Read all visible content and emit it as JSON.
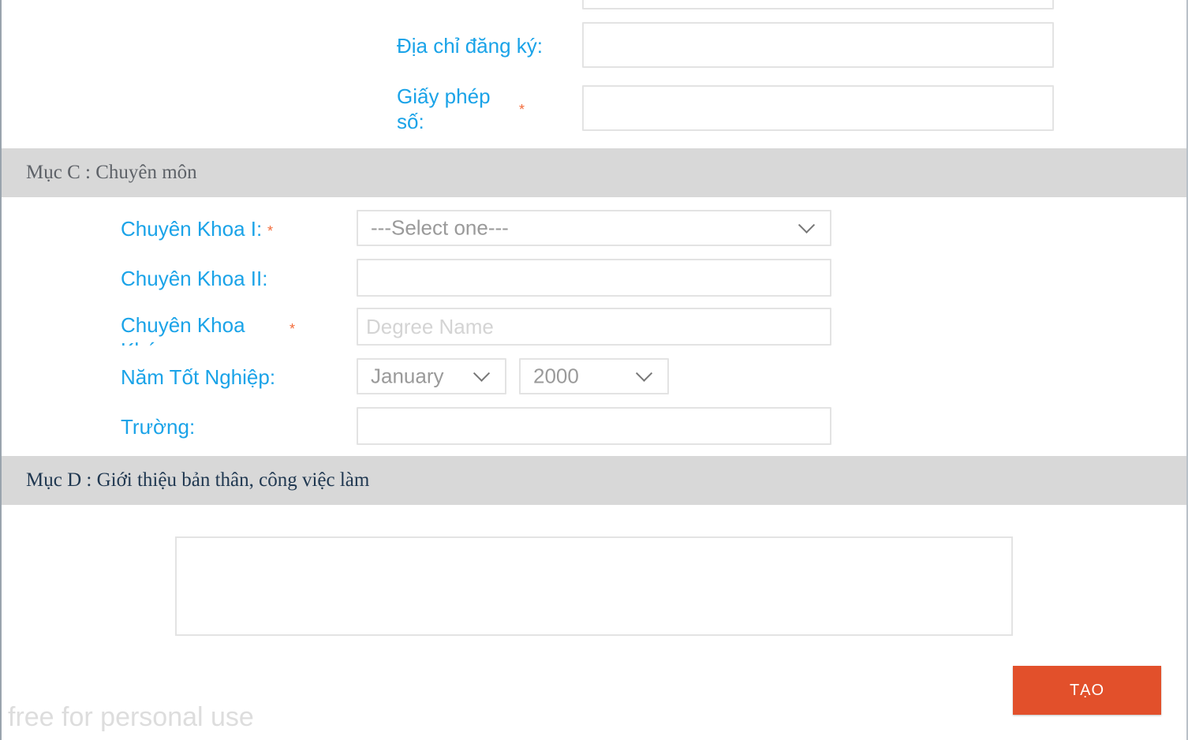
{
  "section_b": {
    "address_label": "Địa chỉ đăng ký:",
    "address_value": "",
    "license_label": "Giấy phép số:",
    "license_value": "",
    "required_mark": "*"
  },
  "section_c": {
    "title": "Mục C : Chuyên môn",
    "specialty1_label": "Chuyên Khoa I:",
    "specialty1_select": "---Select one---",
    "specialty2_label": "Chuyên Khoa II:",
    "specialty2_value": "",
    "other_specialty_label": "Chuyên Khoa Khác:",
    "degree_placeholder": "Degree Name",
    "graduation_label": "Năm Tốt Nghiệp:",
    "graduation_month": "January",
    "graduation_year": "2000",
    "school_label": "Trường:",
    "school_value": "",
    "required_mark": "*"
  },
  "section_d": {
    "title": "Mục D : Giới thiệu bản thân, công việc làm",
    "intro_value": ""
  },
  "actions": {
    "create_label": "TẠO"
  },
  "watermark": "free for personal use"
}
